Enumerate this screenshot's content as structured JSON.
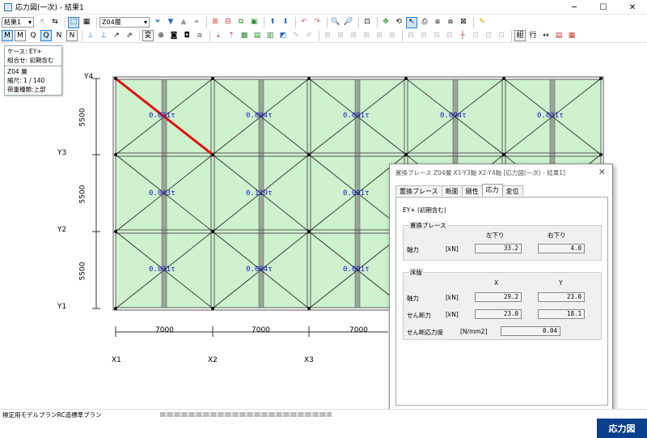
{
  "window": {
    "title": "応力図(一次) - 結果1"
  },
  "toolbar": {
    "result_select": "結果1",
    "floor_select": "Z04層",
    "mode_buttons": [
      "M",
      "M",
      "Q",
      "Q",
      "N",
      "N"
    ],
    "henkei_label": "変",
    "kumi_label": "組",
    "gyou_label": "行"
  },
  "info": {
    "case": "ケース: EY+",
    "combo": "組合せ: 初期含む",
    "floor": "Z04 層",
    "scale": "縮尺: 1 / 140",
    "load_type": "荷重種類:上部"
  },
  "plan": {
    "row_labels": [
      "Y4",
      "Y3",
      "Y2",
      "Y1"
    ],
    "col_labels": [
      "X1",
      "X2",
      "X3"
    ],
    "spans_y": [
      "5500",
      "5500",
      "5500"
    ],
    "spans_x": [
      "7000",
      "7000",
      "7000"
    ],
    "row1_values": [
      "0.031τ",
      "0.094τ",
      "0.091τ",
      "0.094τ",
      "0.031τ"
    ],
    "row2_values": [
      "0.043τ",
      "0.119τ",
      "0.091τ"
    ],
    "row3_values": [
      "0.031τ",
      "0.094τ",
      "0.091τ"
    ]
  },
  "dialog": {
    "title": "置換ブレース Z04層 X1-Y3軸 X2-Y4軸 [応力図(一次) - 結果1]",
    "tabs": [
      "置換ブレース",
      "断面",
      "剛性",
      "応力",
      "変位"
    ],
    "case_label": "EY+ (初期含む)",
    "brace_group": "置換ブレース",
    "brace_col_left": "左下り",
    "brace_col_right": "右下り",
    "axial_label": "軸力",
    "unit_kn": "[kN]",
    "brace_axial_left": "33.2",
    "brace_axial_right": "4.0",
    "slab_group": "床版",
    "col_x": "X",
    "col_y": "Y",
    "slab_axial_label": "軸力",
    "slab_axial_x": "29.2",
    "slab_axial_y": "23.0",
    "shear_label": "せん断力",
    "shear_x": "23.0",
    "shear_y": "18.1",
    "shear_stress_label": "せん断応力度",
    "unit_stress": "[N/mm2]",
    "shear_stress": "0.04"
  },
  "status": {
    "text": "検定用モデルプランRC造標準プラン"
  },
  "badge": {
    "label": "応力図"
  }
}
